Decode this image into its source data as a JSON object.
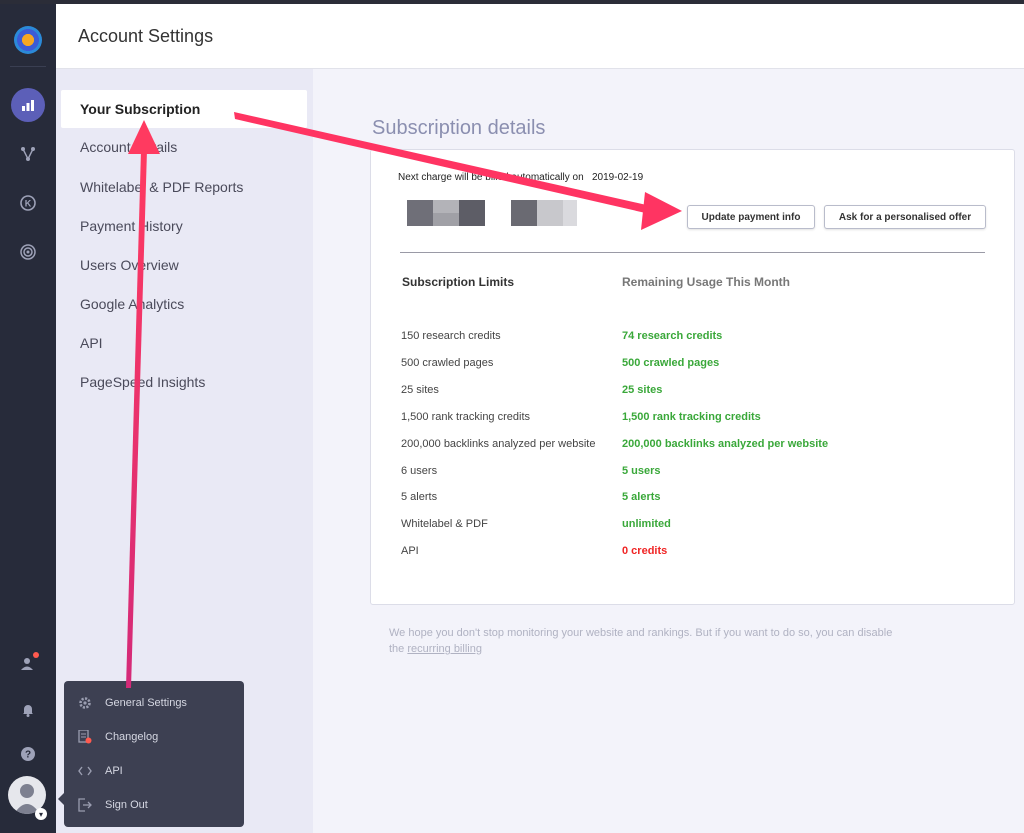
{
  "header": {
    "title": "Account Settings"
  },
  "settings_menu": {
    "items": [
      {
        "label": "Your Subscription",
        "active": true
      },
      {
        "label": "Account Details"
      },
      {
        "label": "Whitelabel & PDF Reports"
      },
      {
        "label": "Payment History"
      },
      {
        "label": "Users Overview"
      },
      {
        "label": "Google Analytics"
      },
      {
        "label": "API"
      },
      {
        "label": "PageSpeed Insights"
      }
    ]
  },
  "rail": {
    "icons": [
      "app-logo-icon",
      "reports-bar-chart-icon",
      "nodes-icon",
      "keyword-k-icon",
      "target-icon",
      "team-icon",
      "bell-icon",
      "help-icon"
    ]
  },
  "main": {
    "section_title": "Subscription details",
    "next_charge_label": "Next charge will be billed automatically on",
    "next_charge_date": "2019-02-19",
    "buttons": {
      "update_payment": "Update payment info",
      "personalised_offer": "Ask for a personalised offer"
    },
    "columns": {
      "limits": "Subscription Limits",
      "remaining": "Remaining Usage This Month"
    },
    "rows": [
      {
        "limit": "150 research credits",
        "remaining": "74 research credits",
        "status": "ok"
      },
      {
        "limit": "500 crawled pages",
        "remaining": "500 crawled pages",
        "status": "ok"
      },
      {
        "limit": "25 sites",
        "remaining": "25 sites",
        "status": "ok"
      },
      {
        "limit": "1,500 rank tracking credits",
        "remaining": "1,500 rank tracking credits",
        "status": "ok"
      },
      {
        "limit": "200,000 backlinks analyzed per website",
        "remaining": "200,000 backlinks analyzed per website",
        "status": "ok"
      },
      {
        "limit": "6 users",
        "remaining": "5 users",
        "status": "ok"
      },
      {
        "limit": "5 alerts",
        "remaining": "5 alerts",
        "status": "ok"
      },
      {
        "limit": "Whitelabel & PDF",
        "remaining": "unlimited",
        "status": "ok"
      },
      {
        "limit": "API",
        "remaining": "0 credits",
        "status": "empty"
      }
    ],
    "footnote": {
      "text": "We hope you don't stop monitoring your website and rankings. But if you want to do so, you can disable the",
      "link": "recurring billing"
    }
  },
  "popup_menu": {
    "items": [
      {
        "label": "General Settings",
        "icon": "gear-icon"
      },
      {
        "label": "Changelog",
        "icon": "changelog-icon"
      },
      {
        "label": "API",
        "icon": "code-icon"
      },
      {
        "label": "Sign Out",
        "icon": "sign-out-icon"
      }
    ]
  },
  "colors": {
    "rail_bg": "#272b3a",
    "accent": "#5c5fb8",
    "ok_green": "#3aa83a",
    "empty_red": "#f02424",
    "annotation_arrow": "#f0306a"
  }
}
